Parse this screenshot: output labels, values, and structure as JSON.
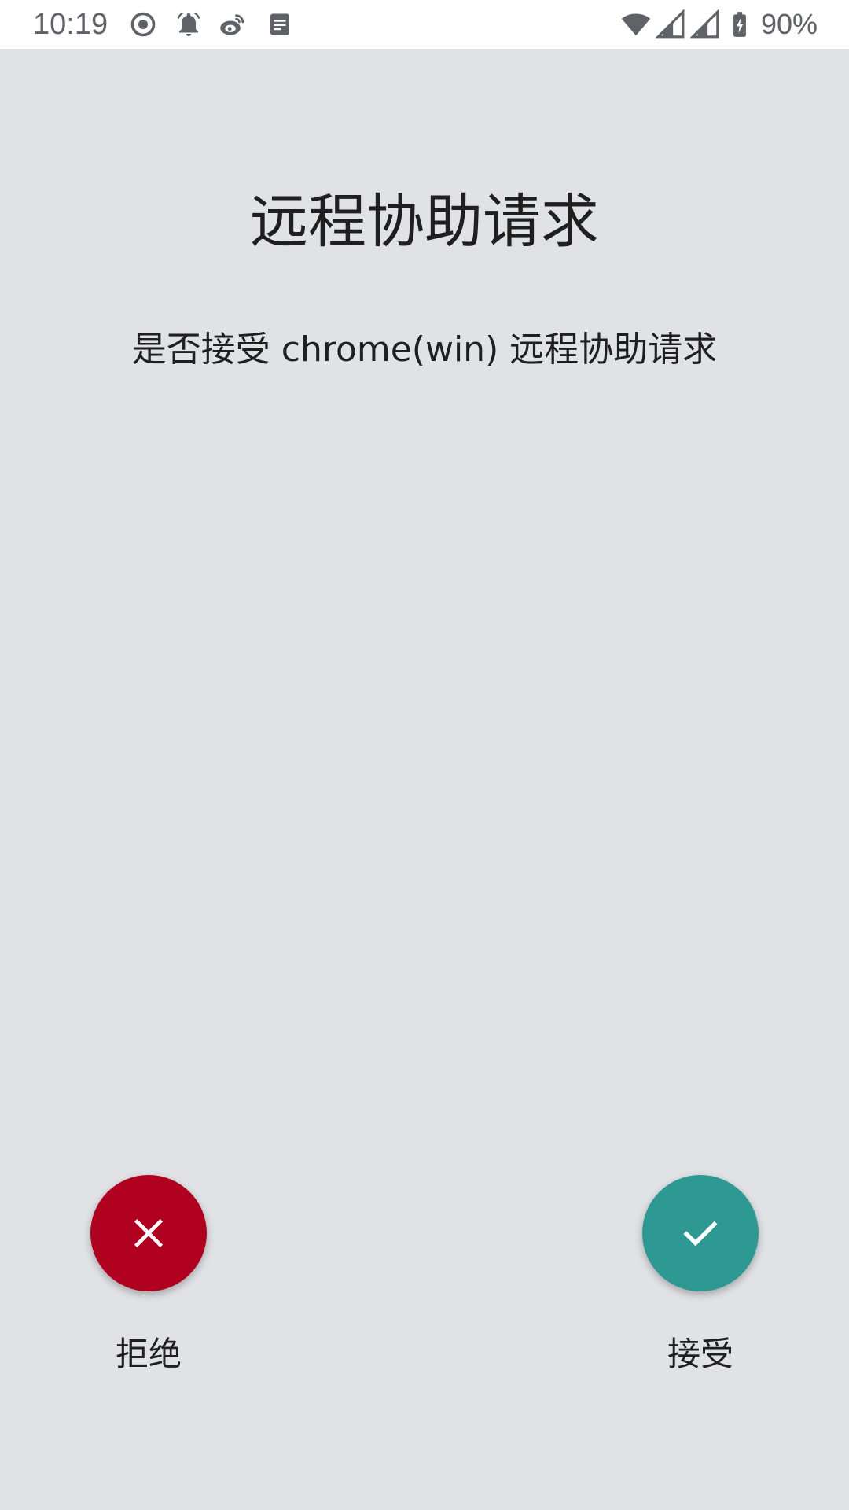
{
  "status_bar": {
    "time": "10:19",
    "battery": "90%",
    "icons": [
      "record-icon",
      "alarm-icon",
      "weibo-icon",
      "document-icon",
      "wifi-icon",
      "signal-icon",
      "signal-icon",
      "battery-charging-icon"
    ]
  },
  "dialog": {
    "title": "远程协助请求",
    "message": "是否接受 chrome(win) 远程协助请求"
  },
  "actions": {
    "reject_label": "拒绝",
    "accept_label": "接受"
  },
  "colors": {
    "background": "#e1e2e5",
    "reject": "#b00020",
    "accept": "#2e9893"
  }
}
